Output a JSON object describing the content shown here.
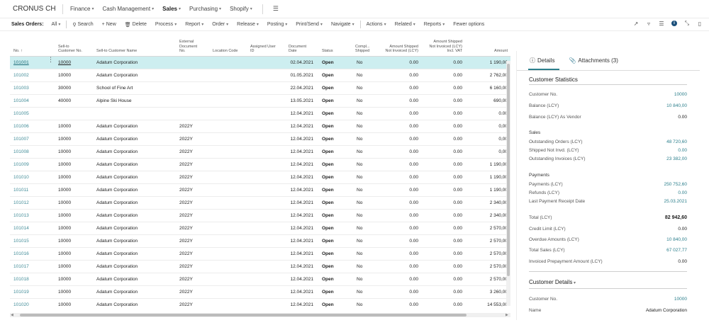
{
  "topnav": {
    "company": "CRONUS CH",
    "items": [
      {
        "label": "Finance"
      },
      {
        "label": "Cash Management"
      },
      {
        "label": "Sales"
      },
      {
        "label": "Purchasing"
      },
      {
        "label": "Shopify"
      }
    ]
  },
  "actionbar": {
    "title": "Sales Orders:",
    "filter": "All",
    "search": "Search",
    "new": "New",
    "delete": "Delete",
    "menus": [
      "Process",
      "Report",
      "Order",
      "Release",
      "Posting",
      "Print/Send",
      "Navigate"
    ],
    "menus2": [
      "Actions",
      "Related",
      "Reports"
    ],
    "fewer": "Fewer options"
  },
  "grid": {
    "headers": {
      "no": "No. ↑",
      "sell_to_no": "Sell-to\nCustomer No.",
      "sell_to_name": "Sell-to Customer Name",
      "ext_doc": "External\nDocument\nNo.",
      "location": "Location Code",
      "assigned": "Assigned User\nID",
      "doc_date": "Document\nDate",
      "status": "Status",
      "completely": "Compl...\nShipped",
      "amt_shipped": "Amount Shipped\nNot Invoiced (LCY)",
      "amt_shipped_vat": "Amount Shipped\nNot Invoiced (LCY)\nIncl. VAT",
      "amount": "Amount"
    },
    "rows": [
      {
        "no": "101001",
        "cust": "10000",
        "name": "Adatum Corporation",
        "ext": "",
        "date": "02.04.2021",
        "status": "Open",
        "shipped": "No",
        "asni": "0.00",
        "asniv": "0.00",
        "amount": "1 190,00"
      },
      {
        "no": "101002",
        "cust": "10000",
        "name": "Adatum Corporation",
        "ext": "",
        "date": "01.05.2021",
        "status": "Open",
        "shipped": "No",
        "asni": "0.00",
        "asniv": "0.00",
        "amount": "2 762,00"
      },
      {
        "no": "101003",
        "cust": "30000",
        "name": "School of Fine Art",
        "ext": "",
        "date": "22.04.2021",
        "status": "Open",
        "shipped": "No",
        "asni": "0.00",
        "asniv": "0.00",
        "amount": "6 160,00"
      },
      {
        "no": "101004",
        "cust": "40000",
        "name": "Alpine Ski House",
        "ext": "",
        "date": "13.05.2021",
        "status": "Open",
        "shipped": "No",
        "asni": "0.00",
        "asniv": "0.00",
        "amount": "690,00"
      },
      {
        "no": "101005",
        "cust": "",
        "name": "",
        "ext": "",
        "date": "12.04.2021",
        "status": "Open",
        "shipped": "No",
        "asni": "0.00",
        "asniv": "0.00",
        "amount": "0.00"
      },
      {
        "no": "101006",
        "cust": "10000",
        "name": "Adatum Corporation",
        "ext": "2022Y",
        "date": "12.04.2021",
        "status": "Open",
        "shipped": "No",
        "asni": "0.00",
        "asniv": "0.00",
        "amount": "0,00"
      },
      {
        "no": "101007",
        "cust": "10000",
        "name": "Adatum Corporation",
        "ext": "2022Y",
        "date": "12.04.2021",
        "status": "Open",
        "shipped": "No",
        "asni": "0.00",
        "asniv": "0.00",
        "amount": "0,00"
      },
      {
        "no": "101008",
        "cust": "10000",
        "name": "Adatum Corporation",
        "ext": "2022Y",
        "date": "12.04.2021",
        "status": "Open",
        "shipped": "No",
        "asni": "0.00",
        "asniv": "0.00",
        "amount": "0,00"
      },
      {
        "no": "101009",
        "cust": "10000",
        "name": "Adatum Corporation",
        "ext": "2022Y",
        "date": "12.04.2021",
        "status": "Open",
        "shipped": "No",
        "asni": "0.00",
        "asniv": "0.00",
        "amount": "1 190,00"
      },
      {
        "no": "101010",
        "cust": "10000",
        "name": "Adatum Corporation",
        "ext": "2022Y",
        "date": "12.04.2021",
        "status": "Open",
        "shipped": "No",
        "asni": "0.00",
        "asniv": "0.00",
        "amount": "1 190,00"
      },
      {
        "no": "101011",
        "cust": "10000",
        "name": "Adatum Corporation",
        "ext": "2022Y",
        "date": "12.04.2021",
        "status": "Open",
        "shipped": "No",
        "asni": "0.00",
        "asniv": "0.00",
        "amount": "1 190,00"
      },
      {
        "no": "101012",
        "cust": "10000",
        "name": "Adatum Corporation",
        "ext": "2022Y",
        "date": "12.04.2021",
        "status": "Open",
        "shipped": "No",
        "asni": "0.00",
        "asniv": "0.00",
        "amount": "2 340,00"
      },
      {
        "no": "101013",
        "cust": "10000",
        "name": "Adatum Corporation",
        "ext": "2022Y",
        "date": "12.04.2021",
        "status": "Open",
        "shipped": "No",
        "asni": "0.00",
        "asniv": "0.00",
        "amount": "2 340,00"
      },
      {
        "no": "101014",
        "cust": "10000",
        "name": "Adatum Corporation",
        "ext": "2022Y",
        "date": "12.04.2021",
        "status": "Open",
        "shipped": "No",
        "asni": "0.00",
        "asniv": "0.00",
        "amount": "2 570,00"
      },
      {
        "no": "101015",
        "cust": "10000",
        "name": "Adatum Corporation",
        "ext": "2022Y",
        "date": "12.04.2021",
        "status": "Open",
        "shipped": "No",
        "asni": "0.00",
        "asniv": "0.00",
        "amount": "2 570,00"
      },
      {
        "no": "101016",
        "cust": "10000",
        "name": "Adatum Corporation",
        "ext": "2022Y",
        "date": "12.04.2021",
        "status": "Open",
        "shipped": "No",
        "asni": "0.00",
        "asniv": "0.00",
        "amount": "2 570,00"
      },
      {
        "no": "101017",
        "cust": "10000",
        "name": "Adatum Corporation",
        "ext": "2022Y",
        "date": "12.04.2021",
        "status": "Open",
        "shipped": "No",
        "asni": "0.00",
        "asniv": "0.00",
        "amount": "2 570,00"
      },
      {
        "no": "101018",
        "cust": "10000",
        "name": "Adatum Corporation",
        "ext": "2022Y",
        "date": "12.04.2021",
        "status": "Open",
        "shipped": "No",
        "asni": "0.00",
        "asniv": "0.00",
        "amount": "2 570,00"
      },
      {
        "no": "101019",
        "cust": "10000",
        "name": "Adatum Corporation",
        "ext": "2022Y",
        "date": "12.04.2021",
        "status": "Open",
        "shipped": "No",
        "asni": "0.00",
        "asniv": "0.00",
        "amount": "3 260,00"
      },
      {
        "no": "101020",
        "cust": "10000",
        "name": "Adatum Corporation",
        "ext": "2022Y",
        "date": "12.04.2021",
        "status": "Open",
        "shipped": "No",
        "asni": "0.00",
        "asniv": "0.00",
        "amount": "14 553,00"
      }
    ]
  },
  "factbox": {
    "tab_details": "Details",
    "tab_attachments": "Attachments (3)",
    "stats_title": "Customer Statistics",
    "customer_no_label": "Customer No.",
    "customer_no": "10000",
    "balance_label": "Balance (LCY)",
    "balance": "10 840,00",
    "balance_vendor_label": "Balance (LCY) As Vendor",
    "balance_vendor": "0.00",
    "sales_title": "Sales",
    "outstanding_orders_label": "Outstanding Orders (LCY)",
    "outstanding_orders": "48 720,60",
    "shipped_not_invd_label": "Shipped Not Invd. (LCY)",
    "shipped_not_invd": "0.00",
    "outstanding_invoices_label": "Outstanding Invoices (LCY)",
    "outstanding_invoices": "23 382,00",
    "payments_title": "Payments",
    "payments_label": "Payments (LCY)",
    "payments": "250 752,60",
    "refunds_label": "Refunds (LCY)",
    "refunds": "0.00",
    "last_payment_label": "Last Payment Receipt Date",
    "last_payment": "25.03.2021",
    "total_label": "Total (LCY)",
    "total": "82 942,60",
    "credit_limit_label": "Credit Limit (LCY)",
    "credit_limit": "0.00",
    "overdue_label": "Overdue Amounts (LCY)",
    "overdue": "10 840,00",
    "total_sales_label": "Total Sales (LCY)",
    "total_sales": "67 027,77",
    "prepayment_label": "Invoiced Prepayment Amount (LCY)",
    "prepayment": "0.00",
    "details_title": "Customer Details",
    "details_customer_no_label": "Customer No.",
    "details_customer_no": "10000",
    "details_name_label": "Name",
    "details_name": "Adatum Corporation"
  }
}
